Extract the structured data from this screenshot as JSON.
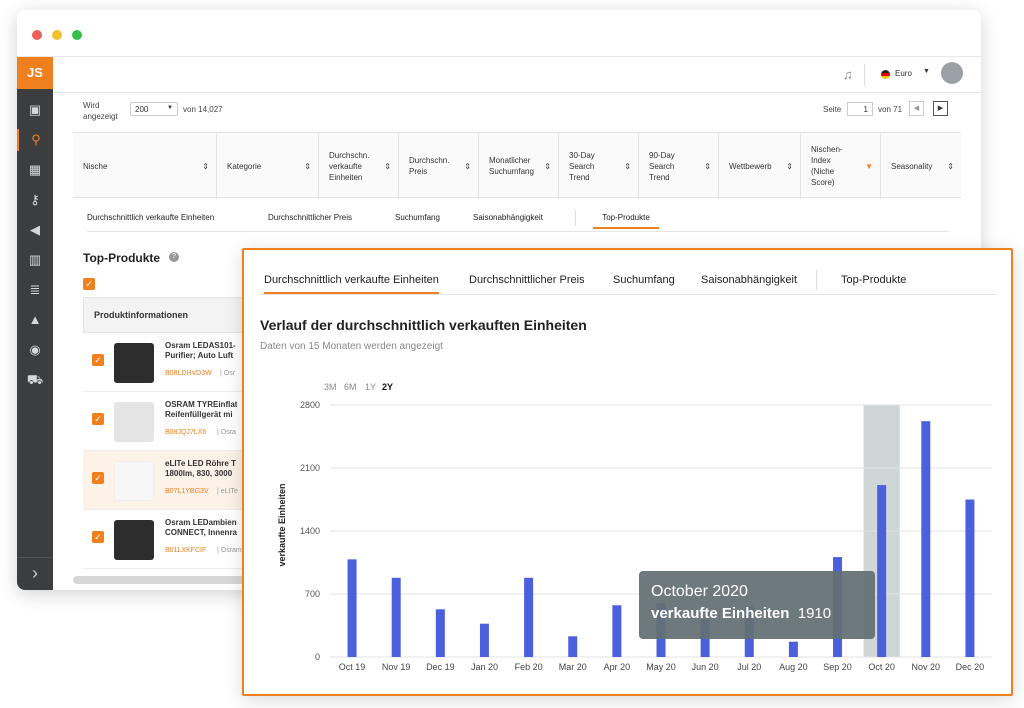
{
  "header": {
    "currency": "Euro"
  },
  "sidebar": {
    "logo": "JS"
  },
  "paging": {
    "shown_label_1": "Wird",
    "shown_label_2": "angezeigt",
    "per_page": "200",
    "of_total": "von 14,027",
    "page_label": "Seite",
    "page_value": "1",
    "of_pages": "von 71"
  },
  "table": {
    "columns": [
      "Nische",
      "Kategorie",
      "Durchschn. verkaufte Einheiten",
      "Durchschn. Preis",
      "Monatlicher Suchumfang",
      "30-Day Search Trend",
      "90-Day Search Trend",
      "Wettbewerb",
      "Nischen-Index (Niche Score)",
      "Seasonality"
    ]
  },
  "back_tabs": [
    "Durchschnittlich verkaufte Einheiten",
    "Durchschnittlicher Preis",
    "Suchumfang",
    "Saisonabhängigkeit",
    "Top-Produkte"
  ],
  "top_products": {
    "title": "Top-Produkte",
    "column": "Produktinformationen",
    "items": [
      {
        "title1": "Osram LEDAS101-",
        "title2": "Purifier; Auto Luft",
        "asin": "B08LDHVD3W",
        "brand": "| Osr"
      },
      {
        "title1": "OSRAM TYREinflat",
        "title2": "Reifenfüllgerät mi",
        "asin": "B08JQJ7LX6",
        "brand": "| Osra"
      },
      {
        "title1": "eLITe LED Röhre T",
        "title2": "1800lm, 830, 3000",
        "asin": "B07L1YBG3V",
        "brand": "| eLITe"
      },
      {
        "title1": "Osram LEDambien",
        "title2": "CONNECT, Innenra",
        "asin": "B01LXKFCIF",
        "brand": "| Osram"
      }
    ]
  },
  "overlay": {
    "tabs": [
      "Durchschnittlich verkaufte Einheiten",
      "Durchschnittlicher Preis",
      "Suchumfang",
      "Saisonabhängigkeit",
      "Top-Produkte"
    ],
    "title": "Verlauf der durchschnittlich verkauften Einheiten",
    "subtitle": "Daten von 15 Monaten werden angezeigt",
    "ranges": [
      "3M",
      "6M",
      "1Y",
      "2Y"
    ],
    "tooltip": {
      "month": "October 2020",
      "label": "verkaufte Einheiten",
      "value": "1910"
    }
  },
  "chart_data": {
    "type": "bar",
    "categories": [
      "Oct 19",
      "Nov 19",
      "Dec 19",
      "Jan 20",
      "Feb 20",
      "Mar 20",
      "Apr 20",
      "May 20",
      "Jun 20",
      "Jul 20",
      "Aug 20",
      "Sep 20",
      "Oct 20",
      "Nov 20",
      "Dec 20"
    ],
    "values": [
      1085,
      880,
      530,
      370,
      880,
      230,
      575,
      600,
      420,
      560,
      170,
      1110,
      1910,
      2620,
      1750
    ],
    "ylabel": "verkaufte Einheiten",
    "ylim": [
      0,
      2800
    ],
    "yticks": [
      0,
      700,
      1400,
      2100,
      2800
    ],
    "highlight_index": 12,
    "color": "#4a60dd"
  }
}
